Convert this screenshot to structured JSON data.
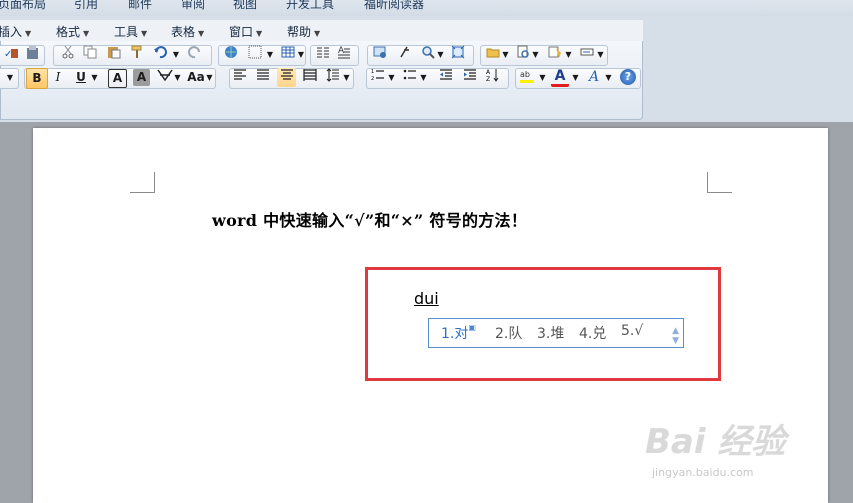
{
  "tabs": [
    "页面布局",
    "引用",
    "邮件",
    "审阅",
    "视图",
    "开发工具",
    "福昕阅读器"
  ],
  "menu": [
    "插入",
    "格式",
    "工具",
    "表格",
    "窗口",
    "帮助"
  ],
  "toolbar": {
    "bold": "B",
    "italic": "I",
    "underline": "U",
    "font_a": "A",
    "font_a_shade": "A",
    "change_case": "Aa",
    "font_color": "A",
    "help": "?"
  },
  "document": {
    "title": "word 中快速输入“√”和“×” 符号的方法！",
    "ime_input": "dui",
    "candidates": [
      "1.对",
      "2.队",
      "3.堆",
      "4.兑",
      "5.√"
    ]
  },
  "watermark": {
    "logo": "Bai 经验",
    "url": "jingyan.baidu.com"
  },
  "colors": {
    "highlight_box": "#e0393e",
    "ime_border": "#5a8ed0",
    "candidate_selected": "#2e6fc8"
  }
}
